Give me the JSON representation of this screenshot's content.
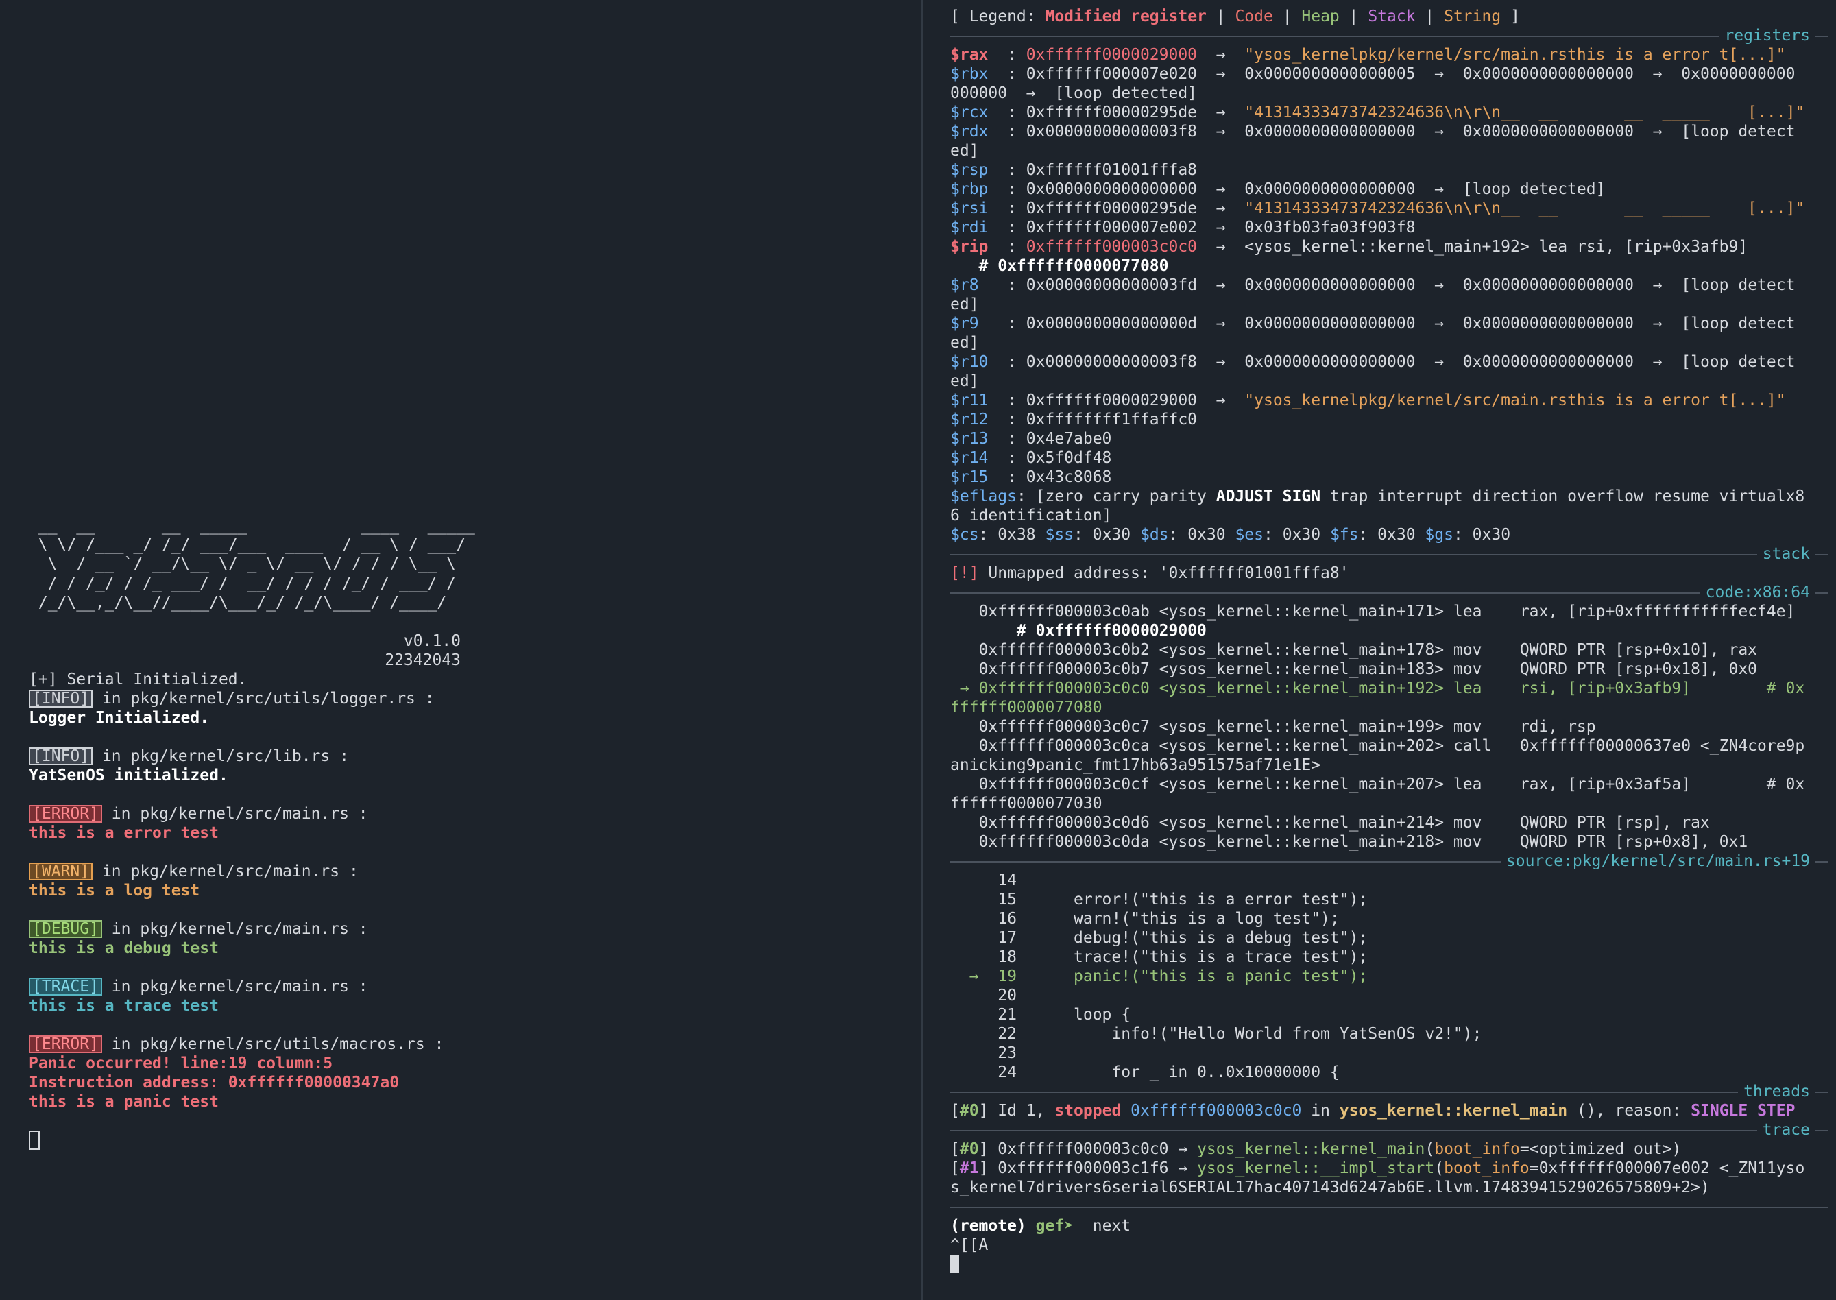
{
  "left": {
    "ascii_logo": [
      " __  __       __  _____            ____   _____",
      " \\ \\/ /___ _/ /_/ ___/___  ____  / __ \\ / ___/",
      "  \\  / __ `/ __/\\__ \\/ _ \\/ __ \\/ / / / \\__ \\",
      "  / / /_/ / /_ ___/ /  __/ / / / /_/ / ___/ /",
      " /_/\\__,_/\\__//____/\\___/_/ /_/\\____/ /____/"
    ],
    "version": "v0.1.0",
    "student_id": "22342043",
    "serial_line": "[+] Serial Initialized.",
    "logs": [
      {
        "level": "INFO",
        "badge": "[INFO]",
        "location": " in pkg/kernel/src/utils/logger.rs :",
        "message": "Logger Initialized."
      },
      {
        "level": "INFO",
        "badge": "[INFO]",
        "location": " in pkg/kernel/src/lib.rs :",
        "message": "YatSenOS initialized."
      },
      {
        "level": "ERROR",
        "badge": "[ERROR]",
        "location": " in pkg/kernel/src/main.rs :",
        "message": "this is a error test"
      },
      {
        "level": "WARN",
        "badge": "[WARN]",
        "location": " in pkg/kernel/src/main.rs :",
        "message": "this is a log test"
      },
      {
        "level": "DEBUG",
        "badge": "[DEBUG]",
        "location": " in pkg/kernel/src/main.rs :",
        "message": "this is a debug test"
      },
      {
        "level": "TRACE",
        "badge": "[TRACE]",
        "location": " in pkg/kernel/src/main.rs :",
        "message": "this is a trace test"
      }
    ],
    "panic": {
      "badge": "[ERROR]",
      "location": " in pkg/kernel/src/utils/macros.rs :",
      "line1": "Panic occurred! line:19 column:5",
      "line2": "Instruction address: 0xffffff00000347a0",
      "line3": "this is a panic test"
    }
  },
  "legend": {
    "prefix": "[ Legend: ",
    "modified": "Modified register",
    "code": "Code",
    "heap": "Heap",
    "stack": "Stack",
    "string": "String",
    "bar": " | ",
    "suffix": " ]"
  },
  "sections": {
    "registers": "registers",
    "stack": "stack",
    "code": "code:x86:64",
    "source": "source:pkg/kernel/src/main.rs+19",
    "threads": "threads",
    "trace": "trace"
  },
  "registers": [
    {
      "name": "$rax",
      "modified": true,
      "value": "0xffffff0000029000",
      "chain": "  →  ",
      "tail": "\"ysos_kernelpkg/kernel/src/main.rsthis is a error t[...]\"",
      "tail_type": "string"
    },
    {
      "name": "$rbx",
      "modified": false,
      "value": "0xffffff000007e020",
      "chain": "  →  ",
      "tail": "0x0000000000000005  →  0x0000000000000000  →  0x0000000000",
      "tail_type": "plain",
      "wrap": "000000  →  [loop detected]"
    },
    {
      "name": "$rcx",
      "modified": false,
      "value": "0xffffff00000295de",
      "chain": "  →  ",
      "tail": "\"41314333473742324636\\n\\r\\n__  __       __  _____    [...]\"",
      "tail_type": "string"
    },
    {
      "name": "$rdx",
      "modified": false,
      "value": "0x00000000000003f8",
      "chain": "  →  ",
      "tail": "0x0000000000000000  →  0x0000000000000000  →  [loop detect",
      "tail_type": "plain",
      "wrap": "ed]"
    },
    {
      "name": "$rsp",
      "modified": false,
      "value": "0xffffff01001fffa8",
      "chain": "",
      "tail": "",
      "tail_type": "plain"
    },
    {
      "name": "$rbp",
      "modified": false,
      "value": "0x0000000000000000",
      "chain": "  →  ",
      "tail": "0x0000000000000000  →  [loop detected]",
      "tail_type": "plain"
    },
    {
      "name": "$rsi",
      "modified": false,
      "value": "0xffffff00000295de",
      "chain": "  →  ",
      "tail": "\"41314333473742324636\\n\\r\\n__  __       __  _____    [...]\"",
      "tail_type": "string"
    },
    {
      "name": "$rdi",
      "modified": false,
      "value": "0xffffff000007e002",
      "chain": "  →  ",
      "tail": "0x03fb03fa03f903f8",
      "tail_type": "plain"
    },
    {
      "name": "$rip",
      "modified": true,
      "value": "0xffffff000003c0c0",
      "chain": "  →  ",
      "tail": "<ysos_kernel::kernel_main+192> lea rsi, [rip+0x3afb9]",
      "tail_type": "plain",
      "wrap": "   # 0xffffff0000077080",
      "wrap_bold": true
    },
    {
      "name": "$r8",
      "modified": false,
      "value": "0x00000000000003fd",
      "chain": "  →  ",
      "tail": "0x0000000000000000  →  0x0000000000000000  →  [loop detect",
      "tail_type": "plain",
      "wrap": "ed]"
    },
    {
      "name": "$r9",
      "modified": false,
      "value": "0x000000000000000d",
      "chain": "  →  ",
      "tail": "0x0000000000000000  →  0x0000000000000000  →  [loop detect",
      "tail_type": "plain",
      "wrap": "ed]"
    },
    {
      "name": "$r10",
      "modified": false,
      "value": "0x00000000000003f8",
      "chain": "  →  ",
      "tail": "0x0000000000000000  →  0x0000000000000000  →  [loop detect",
      "tail_type": "plain",
      "wrap": "ed]"
    },
    {
      "name": "$r11",
      "modified": false,
      "value": "0xffffff0000029000",
      "chain": "  →  ",
      "tail": "\"ysos_kernelpkg/kernel/src/main.rsthis is a error t[...]\"",
      "tail_type": "string"
    },
    {
      "name": "$r12",
      "modified": false,
      "value": "0xffffffff1ffaffc0",
      "chain": "",
      "tail": "",
      "tail_type": "plain"
    },
    {
      "name": "$r13",
      "modified": false,
      "value": "0x4e7abe0",
      "chain": "",
      "tail": "",
      "tail_type": "plain"
    },
    {
      "name": "$r14",
      "modified": false,
      "value": "0x5f0df48",
      "chain": "",
      "tail": "",
      "tail_type": "plain"
    },
    {
      "name": "$r15",
      "modified": false,
      "value": "0x43c8068",
      "chain": "",
      "tail": "",
      "tail_type": "plain"
    }
  ],
  "eflags": {
    "name": "$eflags",
    "pre": ": [zero carry parity ",
    "set": "ADJUST SIGN",
    "post": " trap interrupt direction overflow resume virtualx8",
    "wrap": "6 identification]"
  },
  "segments": [
    {
      "name": "$cs",
      "value": ": 0x38 "
    },
    {
      "name": "$ss",
      "value": ": 0x30 "
    },
    {
      "name": "$ds",
      "value": ": 0x30 "
    },
    {
      "name": "$es",
      "value": ": 0x30 "
    },
    {
      "name": "$fs",
      "value": ": 0x30 "
    },
    {
      "name": "$gs",
      "value": ": 0x30"
    }
  ],
  "stack": {
    "mark": "[!]",
    "text": " Unmapped address: '0xffffff01001fffa8'"
  },
  "code": [
    {
      "text": "   0xffffff000003c0ab <ysos_kernel::kernel_main+171> lea    rax, [rip+0xfffffffffffecf4e]",
      "current": false
    },
    {
      "text": "       # 0xffffff0000029000",
      "current": false,
      "bold": true
    },
    {
      "text": "   0xffffff000003c0b2 <ysos_kernel::kernel_main+178> mov    QWORD PTR [rsp+0x10], rax",
      "current": false
    },
    {
      "text": "   0xffffff000003c0b7 <ysos_kernel::kernel_main+183> mov    QWORD PTR [rsp+0x18], 0x0",
      "current": false
    },
    {
      "text": " → 0xffffff000003c0c0 <ysos_kernel::kernel_main+192> lea    rsi, [rip+0x3afb9]        # 0x",
      "current": true
    },
    {
      "text": "ffffff0000077080",
      "current": true
    },
    {
      "text": "   0xffffff000003c0c7 <ysos_kernel::kernel_main+199> mov    rdi, rsp",
      "current": false
    },
    {
      "text": "   0xffffff000003c0ca <ysos_kernel::kernel_main+202> call   0xffffff00000637e0 <_ZN4core9p",
      "current": false
    },
    {
      "text": "anicking9panic_fmt17hb63a951575af71e1E>",
      "current": false
    },
    {
      "text": "   0xffffff000003c0cf <ysos_kernel::kernel_main+207> lea    rax, [rip+0x3af5a]        # 0x",
      "current": false
    },
    {
      "text": "ffffff0000077030",
      "current": false
    },
    {
      "text": "   0xffffff000003c0d6 <ysos_kernel::kernel_main+214> mov    QWORD PTR [rsp], rax",
      "current": false
    },
    {
      "text": "   0xffffff000003c0da <ysos_kernel::kernel_main+218> mov    QWORD PTR [rsp+0x8], 0x1",
      "current": false
    }
  ],
  "source": [
    {
      "text": "     14",
      "current": false
    },
    {
      "text": "     15      error!(\"this is a error test\");",
      "current": false
    },
    {
      "text": "     16      warn!(\"this is a log test\");",
      "current": false
    },
    {
      "text": "     17      debug!(\"this is a debug test\");",
      "current": false
    },
    {
      "text": "     18      trace!(\"this is a trace test\");",
      "current": false
    },
    {
      "text": "  →  19      panic!(\"this is a panic test\");",
      "current": true
    },
    {
      "text": "     20",
      "current": false
    },
    {
      "text": "     21      loop {",
      "current": false
    },
    {
      "text": "     22          info!(\"Hello World from YatSenOS v2!\");",
      "current": false
    },
    {
      "text": "     23",
      "current": false
    },
    {
      "text": "     24          for _ in 0..0x10000000 {",
      "current": false
    }
  ],
  "threads": {
    "id": "[#0]",
    "pre": " Id 1, ",
    "stopped": "stopped",
    "addr": " 0xffffff000003c0c0",
    "in": " in ",
    "func": "ysos_kernel::kernel_main",
    "reason_pre": " (), reason: ",
    "reason": "SINGLE STEP"
  },
  "trace": {
    "f0": {
      "id": "[#0]",
      "addr": " 0xffffff000003c0c0 → ",
      "func": "ysos_kernel::kernel_main",
      "open": "(",
      "arg": "boot_info",
      "rest": "=<optimized out>)"
    },
    "f1": {
      "id": "[#1]",
      "addr": " 0xffffff000003c1f6 → ",
      "func": "ysos_kernel::__impl_start",
      "open": "(",
      "arg": "boot_info",
      "rest": "=0xffffff000007e002 <_ZN11yso",
      "wrap": "s_kernel7drivers6serial6SERIAL17hac407143d6247ab6E.llvm.17483941529026575809+2>)"
    }
  },
  "prompt": {
    "remote": "(remote) ",
    "gef": "gef➤ ",
    "command": " next",
    "next_line": "^[[A"
  }
}
